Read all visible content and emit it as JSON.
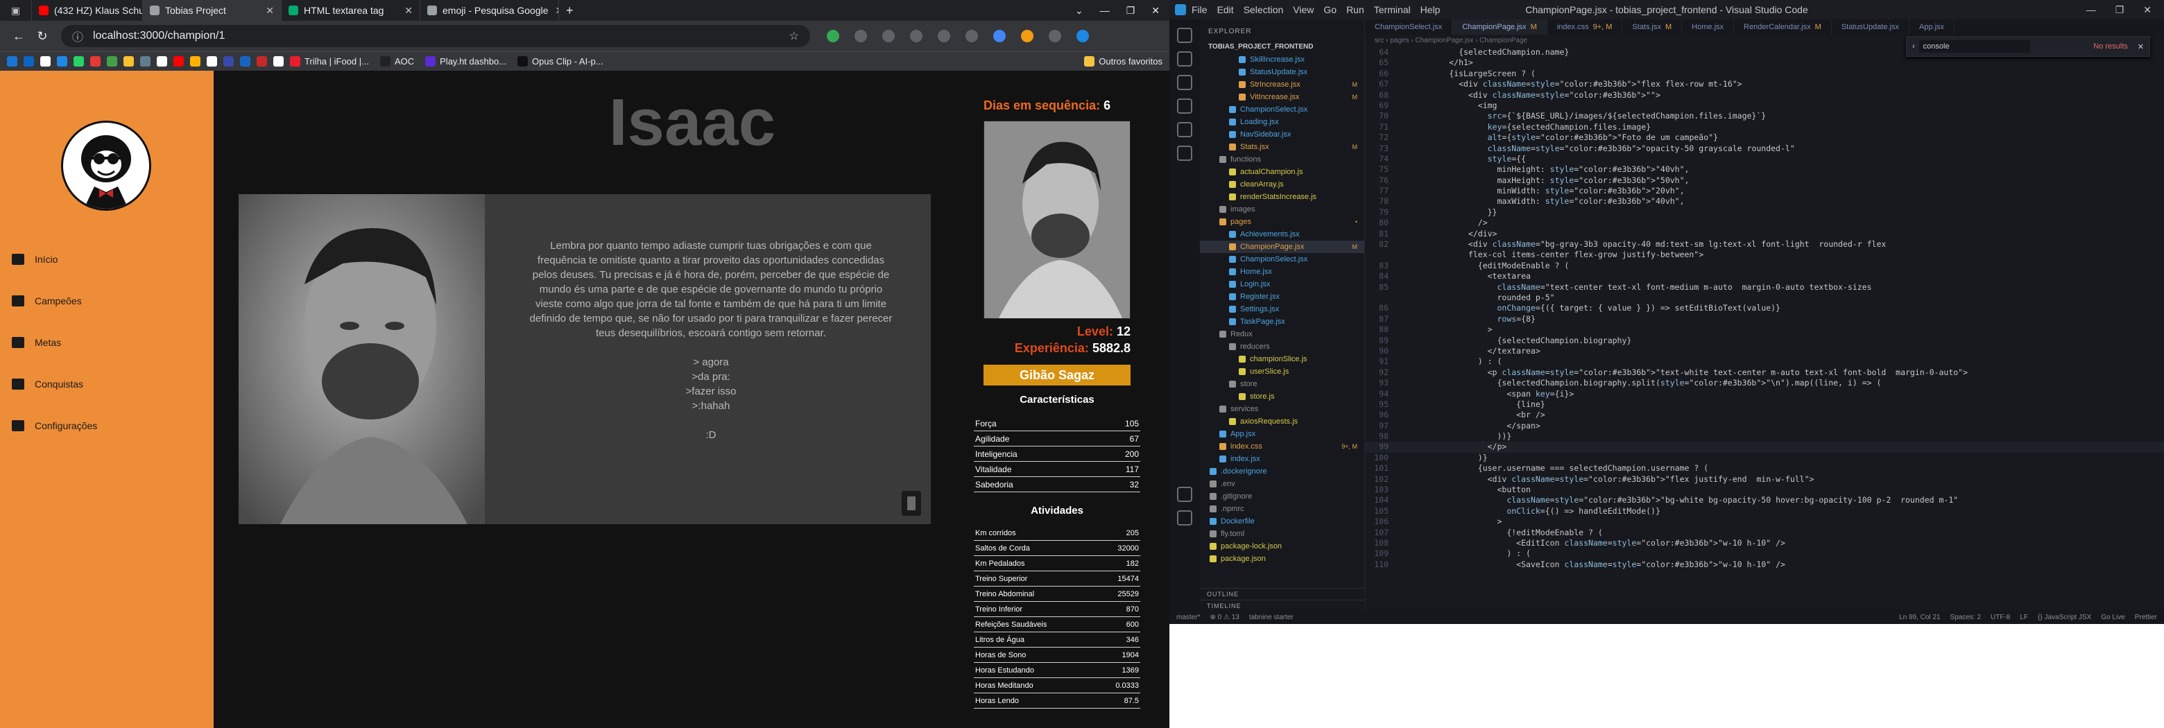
{
  "browser": {
    "tabs": [
      {
        "label": "(432 HZ) Klaus Schul",
        "icon": "youtube-icon",
        "color": "#ff0000"
      },
      {
        "label": "Tobias Project",
        "icon": "page-icon",
        "color": "#9aa0a6"
      },
      {
        "label": "HTML textarea tag",
        "icon": "w3schools-icon",
        "color": "#04aa6d"
      },
      {
        "label": "emoji - Pesquisa Google",
        "icon": "page-icon",
        "color": "#9aa0a6"
      }
    ],
    "new_tab": "+",
    "url": "localhost:3000/champion/1",
    "bookmarks": [
      {
        "label": "",
        "color": "#1976d2"
      },
      {
        "label": "",
        "color": "#0a66c2"
      },
      {
        "label": "",
        "color": "#ffffff"
      },
      {
        "label": "",
        "color": "#1e88e5"
      },
      {
        "label": "",
        "color": "#25d366"
      },
      {
        "label": "",
        "color": "#e53935"
      },
      {
        "label": "",
        "color": "#43a047"
      },
      {
        "label": "",
        "color": "#fbc02d"
      },
      {
        "label": "",
        "color": "#607d8b"
      },
      {
        "label": "",
        "color": "#ffffff"
      },
      {
        "label": "",
        "color": "#ff0000"
      },
      {
        "label": "",
        "color": "#ffb300"
      },
      {
        "label": "",
        "color": "#ffffff"
      },
      {
        "label": "",
        "color": "#3949ab"
      },
      {
        "label": "",
        "color": "#1565c0"
      },
      {
        "label": "",
        "color": "#c62828"
      },
      {
        "label": "",
        "color": "#ffffff"
      }
    ],
    "named_bookmarks": [
      {
        "label": "Trilha | iFood |...",
        "color": "#ea1d2c"
      },
      {
        "label": "AOC",
        "color": "#222222"
      },
      {
        "label": "Play.ht dashbo...",
        "color": "#5b2bd6"
      },
      {
        "label": "Opus Clip - AI-p...",
        "color": "#111111"
      }
    ],
    "other_bookmarks": "Outros favoritos",
    "active_tab_index": 1
  },
  "app": {
    "nav": [
      {
        "label": "Início",
        "icon": "home-icon"
      },
      {
        "label": "Campeões",
        "icon": "swords-icon"
      },
      {
        "label": "Metas",
        "icon": "chart-icon"
      },
      {
        "label": "Conquistas",
        "icon": "trophy-icon"
      },
      {
        "label": "Configurações",
        "icon": "wrench-icon"
      }
    ],
    "champion_name": "Isaac",
    "bio_lines": [
      "Lembra por quanto tempo adiaste cumprir tuas obrigações e com que",
      "frequência te omitiste quanto a tirar proveito das oportunidades concedidas",
      "pelos deuses. Tu precisas e já é hora de, porém, perceber de que espécie de",
      "mundo és uma parte e de que espécie de governante do mundo tu próprio",
      "vieste como algo que jorra de tal fonte e também de que há para ti um limite",
      "definido de tempo que, se não for usado por ti para tranquilizar e fazer perecer",
      "teus desequilíbrios, escoará contigo sem retornar.",
      "",
      "> agora",
      ">da pra:",
      ">fazer isso",
      ">:hahah",
      "",
      ":D"
    ],
    "streak_label": "Dias em sequência:",
    "streak_value": "6",
    "level_label": "Level:",
    "level_value": "12",
    "xp_label": "Experiência:",
    "xp_value": "5882.8",
    "title_badge": "Gibão Sagaz",
    "characteristics_title": "Características",
    "characteristics": [
      {
        "name": "Força",
        "value": "105"
      },
      {
        "name": "Agilidade",
        "value": "67"
      },
      {
        "name": "Inteligencia",
        "value": "200"
      },
      {
        "name": "Vitalidade",
        "value": "117"
      },
      {
        "name": "Sabedoria",
        "value": "32"
      }
    ],
    "activities_title": "Atividades",
    "activities": [
      {
        "name": "Km corridos",
        "value": "205"
      },
      {
        "name": "Saltos de Corda",
        "value": "32000"
      },
      {
        "name": "Km Pedalados",
        "value": "182"
      },
      {
        "name": "Treino Superior",
        "value": "15474"
      },
      {
        "name": "Treino Abdominal",
        "value": "25529"
      },
      {
        "name": "Treino Inferior",
        "value": "870"
      },
      {
        "name": "Refeições Saudáveis",
        "value": "600"
      },
      {
        "name": "Litros de Água",
        "value": "346"
      },
      {
        "name": "Horas de Sono",
        "value": "1904"
      },
      {
        "name": "Horas Estudando",
        "value": "1369"
      },
      {
        "name": "Horas Meditando",
        "value": "0.0333"
      },
      {
        "name": "Horas Lendo",
        "value": "87.5"
      }
    ]
  },
  "vscode": {
    "title": "ChampionPage.jsx - tobias_project_frontend - Visual Studio Code",
    "menu": [
      "File",
      "Edit",
      "Selection",
      "View",
      "Go",
      "Run",
      "Terminal",
      "Help"
    ],
    "explorer_title": "EXPLORER",
    "project": "TOBIAS_PROJECT_FRONTEND",
    "tabs": [
      {
        "label": "ChampionSelect.jsx",
        "status": "",
        "active": false
      },
      {
        "label": "ChampionPage.jsx",
        "status": "M",
        "active": true
      },
      {
        "label": "index.css",
        "status": "9+, M",
        "active": false
      },
      {
        "label": "Stats.jsx",
        "status": "M",
        "active": false
      },
      {
        "label": "Home.jsx",
        "status": "",
        "active": false
      },
      {
        "label": "RenderCalendar.jsx",
        "status": "M",
        "active": false
      },
      {
        "label": "StatusUpdate.jsx",
        "status": "",
        "active": false
      },
      {
        "label": "App.jsx",
        "status": "",
        "active": false
      }
    ],
    "breadcrumb": "src › pages › ChampionPage.jsx › ChampionPage",
    "find_query": "console",
    "find_result": "No results",
    "files": [
      {
        "name": "SkillIncrease.jsx",
        "indent": 3,
        "color": "#4fa3e0",
        "badge": ""
      },
      {
        "name": "StatusUpdate.jsx",
        "indent": 3,
        "color": "#4fa3e0",
        "badge": ""
      },
      {
        "name": "StrIncrease.jsx",
        "indent": 3,
        "color": "#e0a04a",
        "badge": "M"
      },
      {
        "name": "VitIncrease.jsx",
        "indent": 3,
        "color": "#e0a04a",
        "badge": "M"
      },
      {
        "name": "ChampionSelect.jsx",
        "indent": 2,
        "color": "#4fa3e0",
        "badge": ""
      },
      {
        "name": "Loading.jsx",
        "indent": 2,
        "color": "#4fa3e0",
        "badge": ""
      },
      {
        "name": "NavSidebar.jsx",
        "indent": 2,
        "color": "#4fa3e0",
        "badge": ""
      },
      {
        "name": "Stats.jsx",
        "indent": 2,
        "color": "#e0a04a",
        "badge": "M"
      },
      {
        "name": "functions",
        "indent": 1,
        "color": "#8f8f8f",
        "badge": ""
      },
      {
        "name": "actualChampion.js",
        "indent": 2,
        "color": "#d7c94a",
        "badge": ""
      },
      {
        "name": "cleanArray.js",
        "indent": 2,
        "color": "#d7c94a",
        "badge": ""
      },
      {
        "name": "renderStatsIncrease.js",
        "indent": 2,
        "color": "#d7c94a",
        "badge": ""
      },
      {
        "name": "images",
        "indent": 1,
        "color": "#8f8f8f",
        "badge": ""
      },
      {
        "name": "pages",
        "indent": 1,
        "color": "#e0a04a",
        "badge": "•"
      },
      {
        "name": "Achievements.jsx",
        "indent": 2,
        "color": "#4fa3e0",
        "badge": ""
      },
      {
        "name": "ChampionPage.jsx",
        "indent": 2,
        "color": "#e0a04a",
        "badge": "M"
      },
      {
        "name": "ChampionSelect.jsx",
        "indent": 2,
        "color": "#4fa3e0",
        "badge": ""
      },
      {
        "name": "Home.jsx",
        "indent": 2,
        "color": "#4fa3e0",
        "badge": ""
      },
      {
        "name": "Login.jsx",
        "indent": 2,
        "color": "#4fa3e0",
        "badge": ""
      },
      {
        "name": "Register.jsx",
        "indent": 2,
        "color": "#4fa3e0",
        "badge": ""
      },
      {
        "name": "Settings.jsx",
        "indent": 2,
        "color": "#4fa3e0",
        "badge": ""
      },
      {
        "name": "TaskPage.jsx",
        "indent": 2,
        "color": "#4fa3e0",
        "badge": ""
      },
      {
        "name": "Redux",
        "indent": 1,
        "color": "#8f8f8f",
        "badge": ""
      },
      {
        "name": "reducers",
        "indent": 2,
        "color": "#8f8f8f",
        "badge": ""
      },
      {
        "name": "championSlice.js",
        "indent": 3,
        "color": "#d7c94a",
        "badge": ""
      },
      {
        "name": "userSlice.js",
        "indent": 3,
        "color": "#d7c94a",
        "badge": ""
      },
      {
        "name": "store",
        "indent": 2,
        "color": "#8f8f8f",
        "badge": ""
      },
      {
        "name": "store.js",
        "indent": 3,
        "color": "#d7c94a",
        "badge": ""
      },
      {
        "name": "services",
        "indent": 1,
        "color": "#8f8f8f",
        "badge": ""
      },
      {
        "name": "axiosRequests.js",
        "indent": 2,
        "color": "#d7c94a",
        "badge": ""
      },
      {
        "name": "App.jsx",
        "indent": 1,
        "color": "#4fa3e0",
        "badge": ""
      },
      {
        "name": "index.css",
        "indent": 1,
        "color": "#e0a04a",
        "badge": "9+, M"
      },
      {
        "name": "index.jsx",
        "indent": 1,
        "color": "#4fa3e0",
        "badge": ""
      },
      {
        "name": ".dockerignore",
        "indent": 0,
        "color": "#4fa3e0",
        "badge": ""
      },
      {
        "name": ".env",
        "indent": 0,
        "color": "#8f8f8f",
        "badge": ""
      },
      {
        "name": ".gitignore",
        "indent": 0,
        "color": "#8f8f8f",
        "badge": ""
      },
      {
        "name": ".npmrc",
        "indent": 0,
        "color": "#8f8f8f",
        "badge": ""
      },
      {
        "name": "Dockerfile",
        "indent": 0,
        "color": "#4fa3e0",
        "badge": ""
      },
      {
        "name": "fly.toml",
        "indent": 0,
        "color": "#8f8f8f",
        "badge": ""
      },
      {
        "name": "package-lock.json",
        "indent": 0,
        "color": "#d7c94a",
        "badge": ""
      },
      {
        "name": "package.json",
        "indent": 0,
        "color": "#d7c94a",
        "badge": ""
      }
    ],
    "outline_label": "OUTLINE",
    "timeline_label": "TIMELINE",
    "code": [
      {
        "n": "64",
        "t": "            {selectedChampion.name}"
      },
      {
        "n": "65",
        "t": "          </h1>"
      },
      {
        "n": "66",
        "t": "          {isLargeScreen ? ("
      },
      {
        "n": "67",
        "t": "            <div className=\"flex flex-row mt-16\">"
      },
      {
        "n": "68",
        "t": "              <div className=\"\">"
      },
      {
        "n": "69",
        "t": "                <img"
      },
      {
        "n": "70",
        "t": "                  src={`${BASE_URL}/images/${selectedChampion.files.image}`}"
      },
      {
        "n": "71",
        "t": "                  key={selectedChampion.files.image}"
      },
      {
        "n": "72",
        "t": "                  alt={\"Foto de um campeão\"}"
      },
      {
        "n": "73",
        "t": "                  className=\"opacity-50 grayscale rounded-l\""
      },
      {
        "n": "74",
        "t": "                  style={{"
      },
      {
        "n": "75",
        "t": "                    minHeight: \"40vh\","
      },
      {
        "n": "76",
        "t": "                    maxHeight: \"50vh\","
      },
      {
        "n": "77",
        "t": "                    minWidth: \"20vh\","
      },
      {
        "n": "78",
        "t": "                    maxWidth: \"40vh\","
      },
      {
        "n": "79",
        "t": "                  }}"
      },
      {
        "n": "80",
        "t": "                />"
      },
      {
        "n": "81",
        "t": "              </div>"
      },
      {
        "n": "82",
        "t": "              <div className=\"bg-gray-3b3 opacity-40 md:text-sm lg:text-xl font-light  rounded-r flex"
      },
      {
        "n": "",
        "t": "              flex-col items-center flex-grow justify-between\">"
      },
      {
        "n": "83",
        "t": "                {editModeEnable ? ("
      },
      {
        "n": "84",
        "t": "                  <textarea"
      },
      {
        "n": "85",
        "t": "                    className=\"text-center text-xl font-medium m-auto  margin-0-auto textbox-sizes"
      },
      {
        "n": "",
        "t": "                    rounded p-5\""
      },
      {
        "n": "86",
        "t": "                    onChange={({ target: { value } }) => setEditBioText(value)}"
      },
      {
        "n": "87",
        "t": "                    rows={8}"
      },
      {
        "n": "88",
        "t": "                  >"
      },
      {
        "n": "89",
        "t": "                    {selectedChampion.biography}"
      },
      {
        "n": "90",
        "t": "                  </textarea>"
      },
      {
        "n": "91",
        "t": "                ) : ("
      },
      {
        "n": "92",
        "t": "                  <p className=\"text-white text-center m-auto text-xl font-bold  margin-0-auto\">"
      },
      {
        "n": "93",
        "t": "                    {selectedChampion.biography.split(\"\\n\").map((line, i) => ("
      },
      {
        "n": "94",
        "t": "                      <span key={i}>"
      },
      {
        "n": "95",
        "t": "                        {line}"
      },
      {
        "n": "96",
        "t": "                        <br />"
      },
      {
        "n": "97",
        "t": "                      </span>"
      },
      {
        "n": "98",
        "t": "                    ))}"
      },
      {
        "n": "99",
        "t": "                  </p>"
      },
      {
        "n": "100",
        "t": "                )}"
      },
      {
        "n": "101",
        "t": "                {user.username === selectedChampion.username ? ("
      },
      {
        "n": "102",
        "t": "                  <div className=\"flex justify-end  min-w-full\">"
      },
      {
        "n": "103",
        "t": "                    <button"
      },
      {
        "n": "104",
        "t": "                      className=\"bg-white bg-opacity-50 hover:bg-opacity-100 p-2  rounded m-1\""
      },
      {
        "n": "105",
        "t": "                      onClick={() => handleEditMode()}"
      },
      {
        "n": "106",
        "t": "                    >"
      },
      {
        "n": "107",
        "t": "                      {!editModeEnable ? ("
      },
      {
        "n": "108",
        "t": "                        <EditIcon className=\"w-10 h-10\" />"
      },
      {
        "n": "109",
        "t": "                      ) : ("
      },
      {
        "n": "110",
        "t": "                        <SaveIcon className=\"w-10 h-10\" />"
      }
    ],
    "status_left": [
      "master*",
      "⊗ 0 ⚠ 13",
      "tabnine starter"
    ],
    "status_right": [
      "Ln 99, Col 21",
      "Spaces: 2",
      "UTF-8",
      "LF",
      "{} JavaScript JSX",
      "Go Live",
      "Prettier"
    ]
  }
}
